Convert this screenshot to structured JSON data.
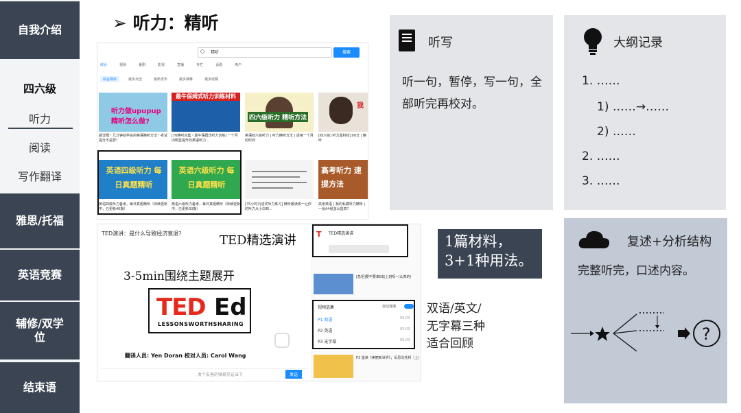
{
  "sidebar": {
    "intro": "自我介绍",
    "cet": "四六级",
    "listening": "听力",
    "reading": "阅读",
    "writing": "写作翻译",
    "ielts": "雅思/托福",
    "contest": "英语竞赛",
    "minor": "辅修/双学位",
    "ending": "结束语"
  },
  "title": "听力：精听",
  "arrow": "➢",
  "panels": {
    "dictation": {
      "title": "听写",
      "text": "听一句，暂停，写一句，全部听完再校对。"
    },
    "outline": {
      "title": "大纲记录",
      "l1": "1. ……",
      "l2": "1) ……→……",
      "l3": "2) ……",
      "l4": "2. ……",
      "l5": "3. ……"
    },
    "retell": {
      "title": "复述+分析结构",
      "text": "完整听完，口述内容。"
    }
  },
  "highlight": {
    "line1": "1篇材料，",
    "line2": "3+1种用法。"
  },
  "side_note": {
    "line1": "双语/英文/",
    "line2": "无字幕三种",
    "line3": "适合回顾"
  },
  "ted": {
    "label": "TED精选演讲",
    "topic": "3-5min围绕主题展开",
    "video_title": "TED演讲：是什么导致经济衰退?",
    "logo_main": "TED",
    "logo_ed": "Ed",
    "logo_sub": "LESSONSWORTHSHARING",
    "subtitle": "翻译人员: Yen Doran 校对人员: Carol Wang",
    "comment_placeholder": "发个友善的弹幕见证当下",
    "send": "发送",
    "playlist_title": "视频选集",
    "auto_play": "自动连播",
    "items": [
      "P1 双语",
      "P2 英语",
      "P3 无字幕"
    ],
    "times": [
      "05:03",
      "05:03",
      "05:03"
    ],
    "channel": "TED精选演讲",
    "related": "[急招]要不要来B站上班呀~(认真的)",
    "related2": "P3 鉴读《美丽新世界》，反思乌托邦（上）"
  },
  "search": {
    "query": "精听",
    "button": "搜索",
    "tabs": [
      "综合",
      "视频",
      "番剧",
      "影视",
      "直播",
      "专栏",
      "话题",
      "用户"
    ],
    "filters": [
      "综合排序",
      "最多点击",
      "最新发布",
      "最多弹幕",
      "最多收藏"
    ]
  },
  "videos": [
    {
      "thumb": "听力做upupup 精听怎么做?",
      "title": "超详细！几分钟就学会的英语精听方法！考试提分不是梦!"
    },
    {
      "thumb": "最牛保姆式听力训练材料",
      "title": "[76精听合集・最牛保姆式听力训练] 一个月内明显提升的英语听力..."
    },
    {
      "thumb": "四六级听力 精听方法",
      "title": "英语四六级听力 | 听力精听方法 | 适用一个月的时间"
    },
    {
      "thumb": "我",
      "title": "[四六级] 听力黑科技200分 | 精听"
    },
    {
      "thumb": "英语四级听力 每日真题精听",
      "title": "英语四级听力备考，每日真题精听（持续更新中，已更新40期）"
    },
    {
      "thumb": "英语六级听力 每日真题精听",
      "title": "英语六级听力备考，每日真题精听（持续更新中，已更新30期）"
    },
    {
      "thumb": "",
      "title": "[75小时沉浸式听力练习] 精听跟读练一让你的听力从小白到..."
    },
    {
      "thumb": "高考听力 速提方法",
      "title": "高考英语 | 我的私藏听力精听 | 一张A4纸怎么提高?"
    }
  ]
}
